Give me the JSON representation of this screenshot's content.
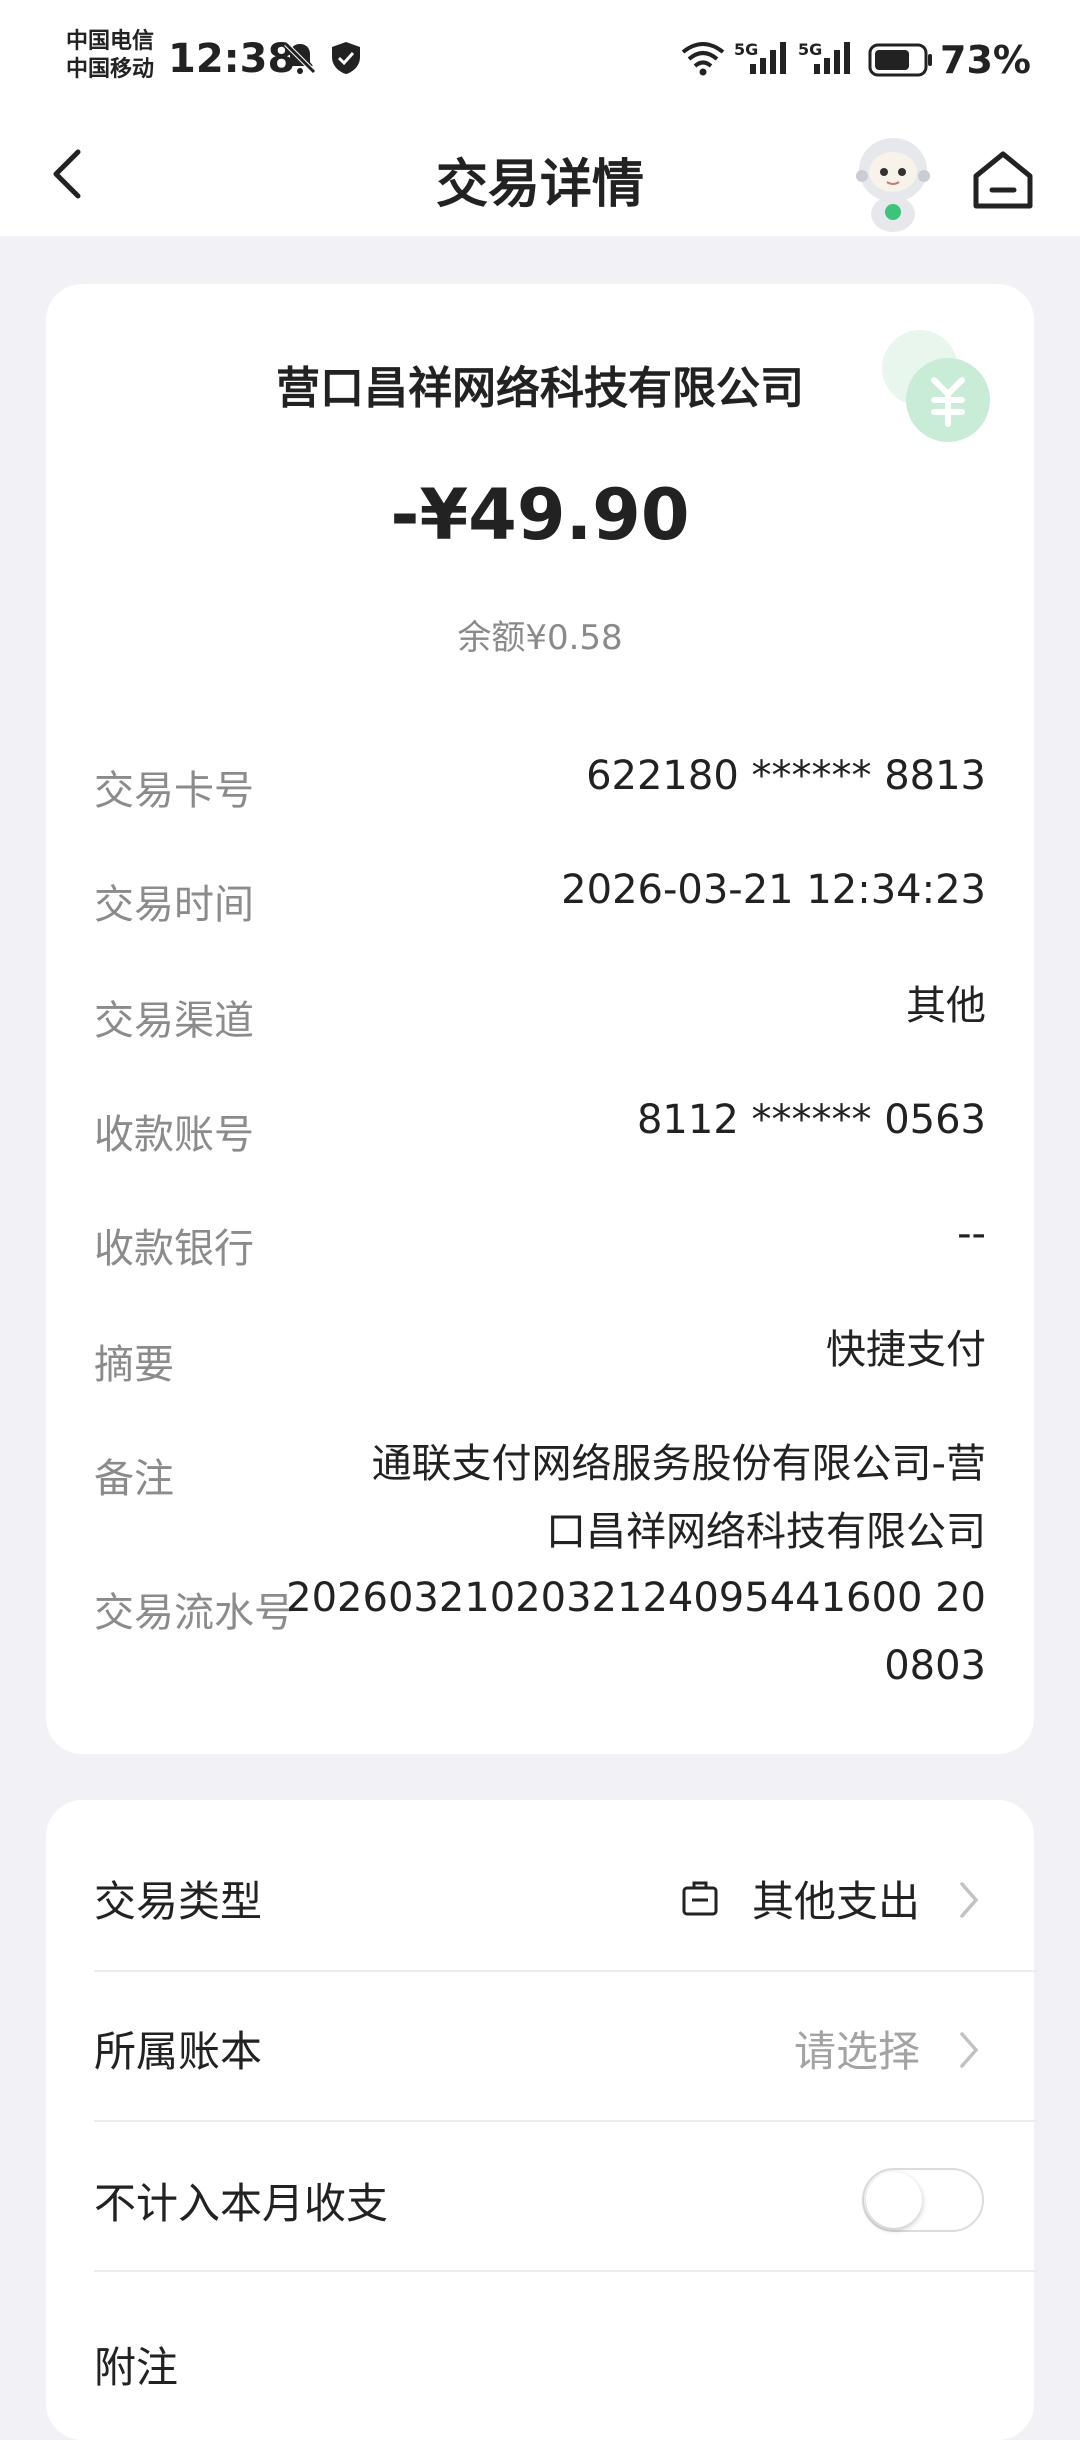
{
  "status_bar": {
    "carrier_1": "中国电信",
    "carrier_2": "中国移动",
    "time": "12:38",
    "network_1": "5G",
    "network_2": "5G",
    "battery": "73%",
    "icons": [
      "bell-off-icon",
      "shield-icon",
      "wifi-icon",
      "signal-icon",
      "battery-icon"
    ]
  },
  "header": {
    "title": "交易详情",
    "back_icon": "chevron-left-icon",
    "mascot": "astronaut-mascot",
    "home_icon": "home-icon"
  },
  "transaction": {
    "merchant": "营口昌祥网络科技有限公司",
    "amount": "-¥49.90",
    "balance": "余额¥0.58",
    "details": [
      {
        "label": "交易卡号",
        "value": "622180 ****** 8813"
      },
      {
        "label": "交易时间",
        "value": "2026-03-21 12:34:23"
      },
      {
        "label": "交易渠道",
        "value": "其他"
      },
      {
        "label": "收款账号",
        "value": "8112 ****** 0563"
      },
      {
        "label": "收款银行",
        "value": "--"
      },
      {
        "label": "摘要",
        "value": "快捷支付"
      },
      {
        "label": "备注",
        "value_line1": "通联支付网络服务股份有限公司-营",
        "value_line2": "口昌祥网络科技有限公司"
      },
      {
        "label": "交易流水号",
        "value_line1": "2026032102032124095441600 20",
        "value_line2": "0803"
      }
    ]
  },
  "settings": {
    "type_label": "交易类型",
    "type_value": "其他支出",
    "type_icon": "briefcase-icon",
    "book_label": "所属账本",
    "book_placeholder": "请选择",
    "exclude_label": "不计入本月收支",
    "exclude_on": false,
    "note_label": "附注"
  },
  "colors": {
    "accent_green": "#3cc47a",
    "muted_text": "#8b8b8b",
    "background": "#f1f1f6"
  }
}
